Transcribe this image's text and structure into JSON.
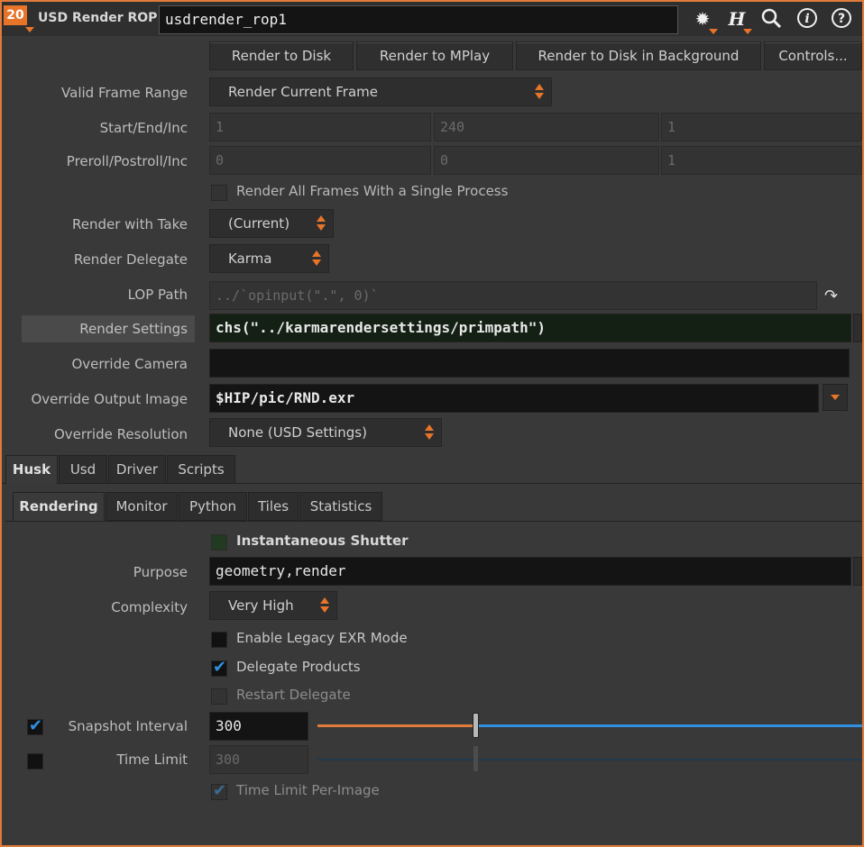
{
  "header": {
    "badge": "20",
    "node_type": "USD Render ROP",
    "node_name": "usdrender_rop1",
    "icons": [
      "gear-icon",
      "houdini-help-icon",
      "search-icon",
      "info-icon",
      "question-icon"
    ]
  },
  "buttons": {
    "render_to_disk": "Render to Disk",
    "render_to_mplay": "Render to MPlay",
    "render_bg": "Render to Disk in Background",
    "controls": "Controls..."
  },
  "params": {
    "valid_frame_range": {
      "label": "Valid Frame Range",
      "value": "Render Current Frame"
    },
    "start_end_inc": {
      "label": "Start/End/Inc",
      "values": [
        "1",
        "240",
        "1"
      ]
    },
    "preroll": {
      "label": "Preroll/Postroll/Inc",
      "values": [
        "0",
        "0",
        "1"
      ]
    },
    "single_process": {
      "label": "Render All Frames With a Single Process"
    },
    "take": {
      "label": "Render with Take",
      "value": "(Current)"
    },
    "delegate": {
      "label": "Render Delegate",
      "value": "Karma"
    },
    "lop_path": {
      "label": "LOP Path",
      "value": "../`opinput(\".\", 0)`"
    },
    "render_settings": {
      "label": "Render Settings",
      "value": "chs(\"../karmarendersettings/primpath\")"
    },
    "override_camera": {
      "label": "Override Camera",
      "value": ""
    },
    "override_output": {
      "label": "Override Output Image",
      "value": "$HIP/pic/RND.exr"
    },
    "override_res": {
      "label": "Override Resolution",
      "value": "None (USD Settings)"
    }
  },
  "tabs": [
    "Husk",
    "Usd",
    "Driver",
    "Scripts"
  ],
  "subtabs": [
    "Rendering",
    "Monitor",
    "Python",
    "Tiles",
    "Statistics"
  ],
  "rendering": {
    "instantaneous_shutter": "Instantaneous Shutter",
    "purpose": {
      "label": "Purpose",
      "value": "geometry,render"
    },
    "complexity": {
      "label": "Complexity",
      "value": "Very High"
    },
    "legacy_exr": "Enable Legacy EXR Mode",
    "delegate_products": "Delegate Products",
    "restart_delegate": "Restart Delegate",
    "snapshot": {
      "label": "Snapshot Interval",
      "value": "300",
      "slider_fraction": 0.29
    },
    "time_limit": {
      "label": "Time Limit",
      "value": "300"
    },
    "time_limit_per_image": "Time Limit Per-Image"
  },
  "colors": {
    "accent": "#e8742a",
    "check": "#2f8fe0",
    "slider_blue": "#2f8fe0",
    "slider_orange": "#e07b3a"
  }
}
